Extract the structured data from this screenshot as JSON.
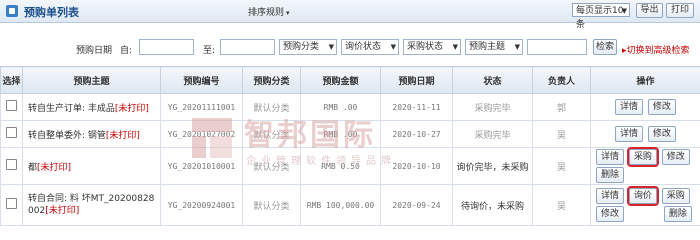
{
  "header": {
    "title": "预购单列表",
    "sort_menu": "排序规则",
    "page_size": "每页显示10条",
    "export_label": "导出",
    "print_label": "打印"
  },
  "search": {
    "date_label": "预购日期",
    "from_label": "自:",
    "to_label": "至:",
    "category_select": "预购分类",
    "inquiry_select": "询价状态",
    "purchase_select": "采购状态",
    "subject_select": "预购主题",
    "search_label": "检索",
    "advanced_label": "切换到高级检索"
  },
  "table": {
    "columns": [
      "选择",
      "预购主题",
      "预购编号",
      "预购分类",
      "预购金额",
      "预购日期",
      "状态",
      "负责人",
      "操作"
    ],
    "rows": [
      {
        "subject": "转自生产订单: 丰成品",
        "tag": "[未打印]",
        "number": "YG_20201111001",
        "category": "默认分类",
        "amount": "RMB  .00",
        "date": "2020-11-11",
        "status": "采购完毕",
        "owner": "郭",
        "actions": [
          "详情",
          "修改"
        ]
      },
      {
        "subject": "转自整单委外: 钢管",
        "tag": "[未打印]",
        "number": "YG_20201027002",
        "category": "默认分类",
        "amount": "RMB  .00",
        "date": "2020-10-27",
        "status": "采购完毕",
        "owner": "吴",
        "actions": [
          "详情",
          "修改"
        ]
      },
      {
        "subject": "都",
        "tag": "[未打印]",
        "number": "YG_20201010001",
        "category": "默认分类",
        "amount": "RMB 0.50",
        "date": "2020-10-10",
        "status": "询价完毕，未采购",
        "owner": "吴",
        "actions": [
          "详情",
          "采购",
          "修改",
          "删除"
        ],
        "highlight": "采购"
      },
      {
        "subject": "转自合同:    料    坏MT_20200828",
        "subject2": "002",
        "tag": "[未打印]",
        "number": "YG_20200924001",
        "category": "默认分类",
        "amount": "RMB 100,000.00",
        "date": "2020-09-24",
        "status": "待询价，未采购",
        "owner": "吴",
        "actions": [
          "详情",
          "询价",
          "采购",
          "修改",
          "删除"
        ],
        "highlight": "询价"
      }
    ]
  },
  "watermark": {
    "name": "智邦国际",
    "slogan": "企业管理软件领导品牌"
  },
  "colors": {
    "accent": "#1b4f8c",
    "warning": "#c00000",
    "highlight_border": "#d9232d"
  }
}
